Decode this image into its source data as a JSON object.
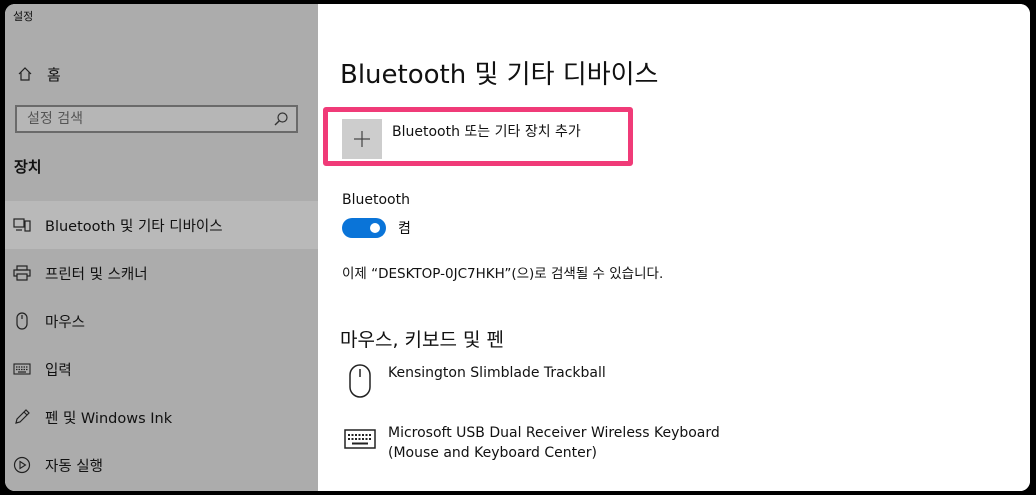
{
  "window": {
    "title": "설정"
  },
  "sidebar": {
    "home_label": "홈",
    "search_placeholder": "설정 검색",
    "section_label": "장치",
    "items": [
      {
        "label": "Bluetooth 및 기타 디바이스",
        "icon": "bluetooth-devices-icon",
        "active": true
      },
      {
        "label": "프린터 및 스캐너",
        "icon": "printer-icon"
      },
      {
        "label": "마우스",
        "icon": "mouse-icon"
      },
      {
        "label": "입력",
        "icon": "keyboard-icon"
      },
      {
        "label": "펜 및 Windows Ink",
        "icon": "pen-icon"
      },
      {
        "label": "자동 실행",
        "icon": "autoplay-icon"
      }
    ]
  },
  "main": {
    "title": "Bluetooth 및 기타 디바이스",
    "add_device_label": "Bluetooth 또는 기타 장치 추가",
    "bluetooth": {
      "label": "Bluetooth",
      "state": "켬",
      "on": true
    },
    "discoverable_text": "이제 “DESKTOP-0JC7HKH”(으)로 검색될 수 있습니다.",
    "section_heading": "마우스, 키보드 및 펜",
    "devices": [
      {
        "line1": "Kensington Slimblade Trackball",
        "icon": "mouse-icon"
      },
      {
        "line1": "Microsoft USB Dual Receiver Wireless Keyboard",
        "line2": "(Mouse and Keyboard Center)",
        "icon": "keyboard-icon"
      }
    ]
  },
  "colors": {
    "sidebar_bg": "#acacac",
    "active_bg": "#b9b9b9",
    "accent": "#0a74d8",
    "highlight": "#f03b78"
  }
}
